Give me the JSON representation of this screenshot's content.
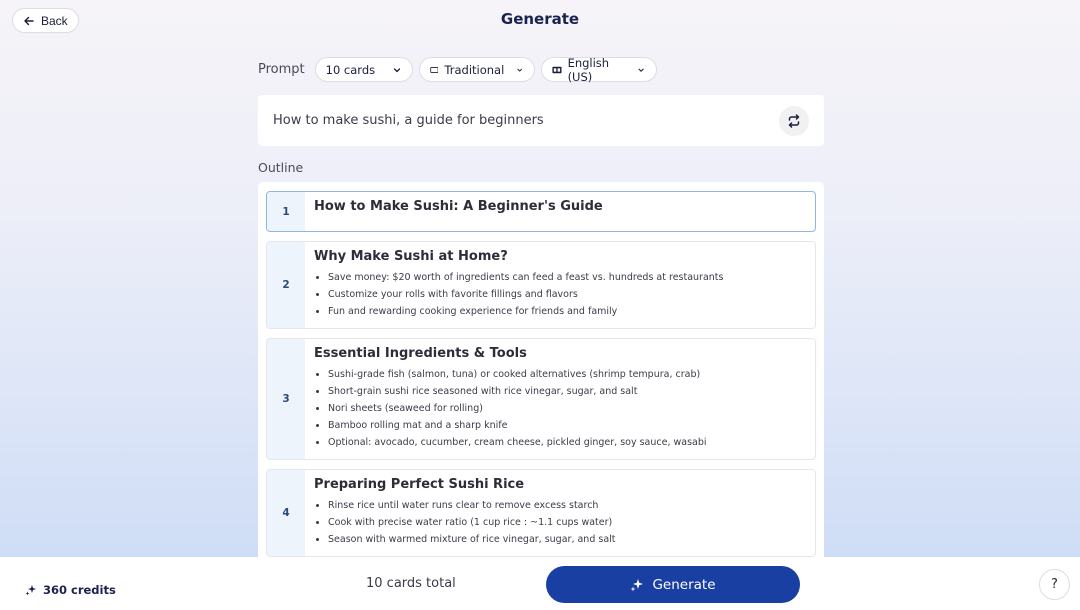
{
  "header": {
    "back_label": "Back",
    "title": "Generate"
  },
  "prompt_settings": {
    "label": "Prompt",
    "card_count": "10 cards",
    "style": "Traditional",
    "language": "English (US)"
  },
  "prompt": {
    "value": "How to make sushi, a guide for beginners"
  },
  "outline": {
    "label": "Outline",
    "cards": [
      {
        "num": "1",
        "title": "How to Make Sushi: A Beginner's Guide",
        "bullets": []
      },
      {
        "num": "2",
        "title": "Why Make Sushi at Home?",
        "bullets": [
          "Save money: $20 worth of ingredients can feed a feast vs. hundreds at restaurants",
          "Customize your rolls with favorite fillings and flavors",
          "Fun and rewarding cooking experience for friends and family"
        ]
      },
      {
        "num": "3",
        "title": "Essential Ingredients & Tools",
        "bullets": [
          "Sushi-grade fish (salmon, tuna) or cooked alternatives (shrimp tempura, crab)",
          "Short-grain sushi rice seasoned with rice vinegar, sugar, and salt",
          "Nori sheets (seaweed for rolling)",
          "Bamboo rolling mat and a sharp knife",
          "Optional: avocado, cucumber, cream cheese, pickled ginger, soy sauce, wasabi"
        ]
      },
      {
        "num": "4",
        "title": "Preparing Perfect Sushi Rice",
        "bullets": [
          "Rinse rice until water runs clear to remove excess starch",
          "Cook with precise water ratio (1 cup rice : ~1.1 cups water)",
          "Season with warmed mixture of rice vinegar, sugar, and salt"
        ]
      }
    ]
  },
  "footer": {
    "credits": "360 credits",
    "total": "10 cards total",
    "generate_label": "Generate",
    "help": "?"
  },
  "colors": {
    "accent": "#1a3fa3",
    "card_number_bg": "#eef4fb"
  }
}
